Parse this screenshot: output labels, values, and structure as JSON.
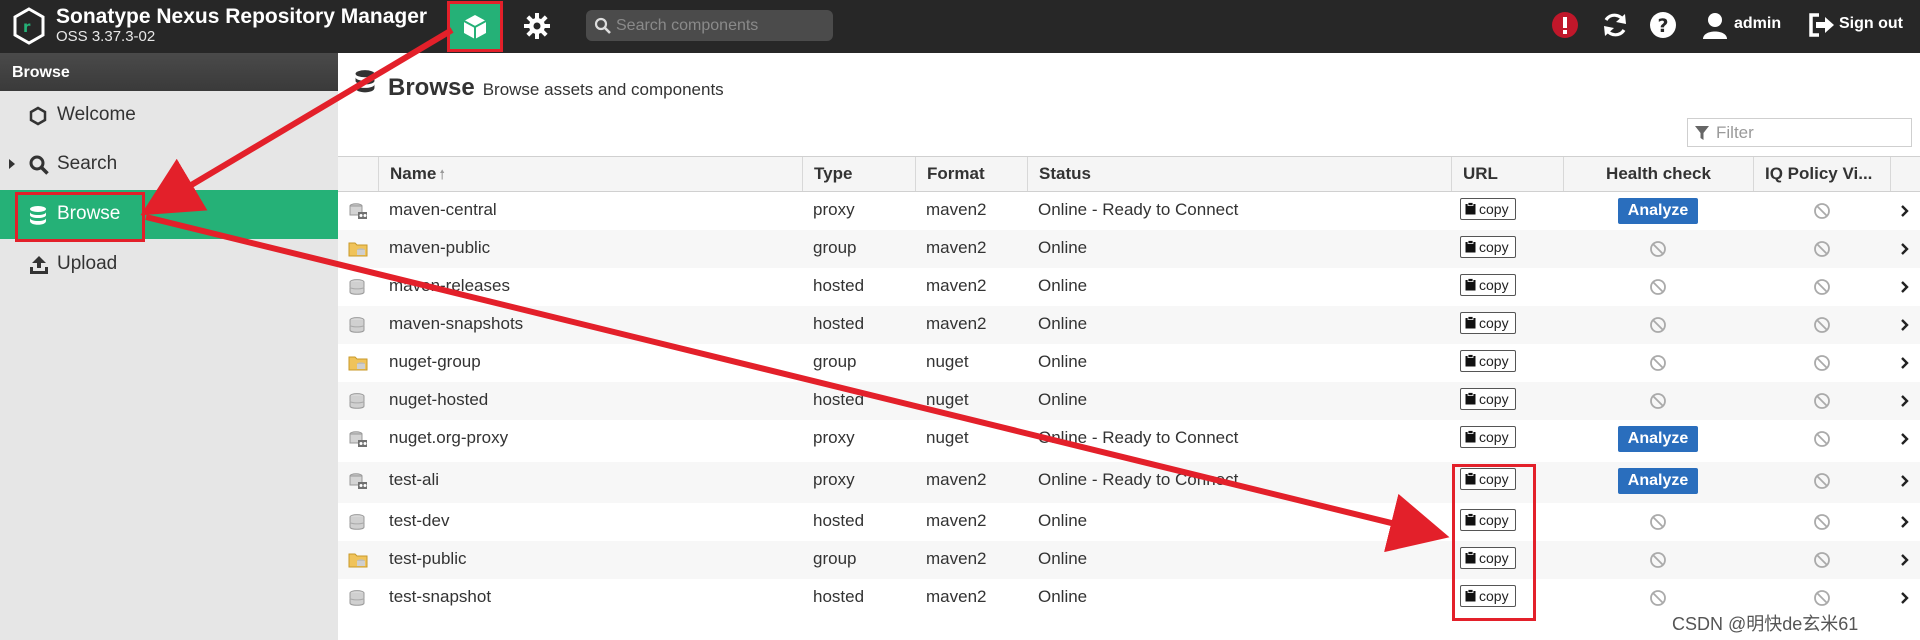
{
  "header": {
    "title": "Sonatype Nexus Repository Manager",
    "version": "OSS 3.37.3-02",
    "search_placeholder": "Search components",
    "user": "admin",
    "signout": "Sign out",
    "icons": [
      "nexus-logo-icon",
      "cube-icon",
      "gear-icon",
      "search-icon",
      "alert-icon",
      "refresh-icon",
      "help-icon",
      "user-icon",
      "signout-icon"
    ],
    "brand_color": "#25b177"
  },
  "sidebar": {
    "header": "Browse",
    "items": [
      {
        "label": "Welcome",
        "icon": "hexagon-icon"
      },
      {
        "label": "Search",
        "icon": "search-icon"
      },
      {
        "label": "Browse",
        "icon": "database-icon"
      },
      {
        "label": "Upload",
        "icon": "upload-icon"
      }
    ],
    "active": "Browse"
  },
  "main": {
    "title": "Browse",
    "subtitle": "Browse assets and components",
    "filter_placeholder": "Filter",
    "columns": [
      "Name",
      "Type",
      "Format",
      "Status",
      "URL",
      "Health check",
      "IQ Policy Vi..."
    ],
    "copy_label": "copy",
    "analyze_label": "Analyze",
    "rows": [
      {
        "name": "maven-central",
        "type": "proxy",
        "format": "maven2",
        "status": "Online - Ready to Connect",
        "health": "analyze"
      },
      {
        "name": "maven-public",
        "type": "group",
        "format": "maven2",
        "status": "Online",
        "health": "disabled"
      },
      {
        "name": "maven-releases",
        "type": "hosted",
        "format": "maven2",
        "status": "Online",
        "health": "disabled"
      },
      {
        "name": "maven-snapshots",
        "type": "hosted",
        "format": "maven2",
        "status": "Online",
        "health": "disabled"
      },
      {
        "name": "nuget-group",
        "type": "group",
        "format": "nuget",
        "status": "Online",
        "health": "disabled"
      },
      {
        "name": "nuget-hosted",
        "type": "hosted",
        "format": "nuget",
        "status": "Online",
        "health": "disabled"
      },
      {
        "name": "nuget.org-proxy",
        "type": "proxy",
        "format": "nuget",
        "status": "Online - Ready to Connect",
        "health": "analyze"
      },
      {
        "name": "test-ali",
        "type": "proxy",
        "format": "maven2",
        "status": "Online - Ready to Connect",
        "health": "analyze"
      },
      {
        "name": "test-dev",
        "type": "hosted",
        "format": "maven2",
        "status": "Online",
        "health": "disabled"
      },
      {
        "name": "test-public",
        "type": "group",
        "format": "maven2",
        "status": "Online",
        "health": "disabled"
      },
      {
        "name": "test-snapshot",
        "type": "hosted",
        "format": "maven2",
        "status": "Online",
        "health": "disabled"
      }
    ]
  },
  "watermark": "CSDN @明快de玄米61",
  "annotation_color": "#e3202a"
}
